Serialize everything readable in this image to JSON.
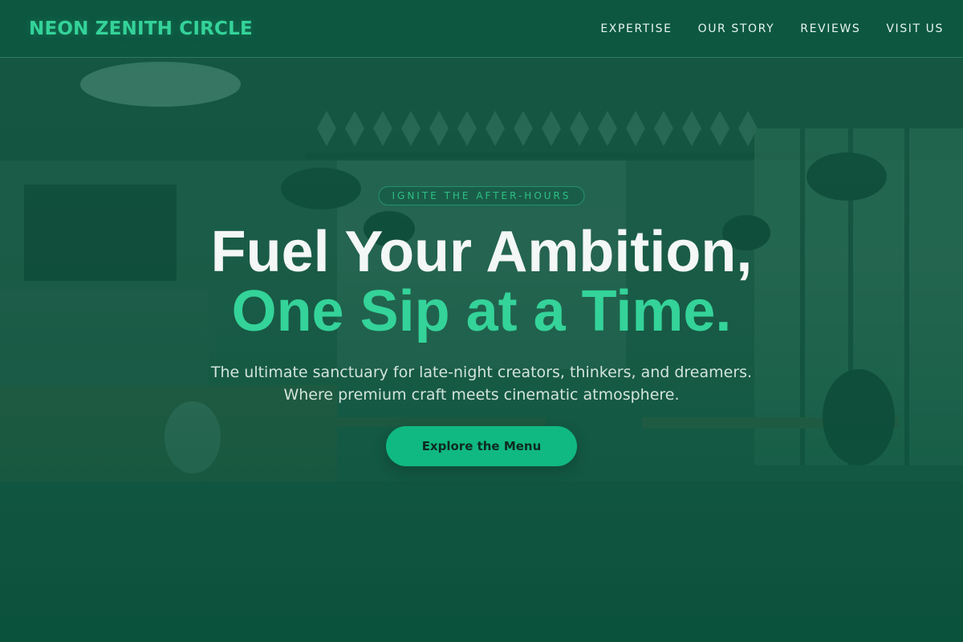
{
  "brand": {
    "name": "NEON ZENITH CIRCLE",
    "accent_color": "#34d399"
  },
  "nav": {
    "items": [
      {
        "label": "EXPERTISE"
      },
      {
        "label": "OUR STORY"
      },
      {
        "label": "REVIEWS"
      },
      {
        "label": "VISIT US"
      }
    ]
  },
  "hero": {
    "tagline": "IGNITE THE AFTER-HOURS",
    "headline_line1": "Fuel Your Ambition,",
    "headline_line2": "One Sip at a Time.",
    "subtitle": "The ultimate sanctuary for late-night creators, thinkers, and dreamers. Where premium craft meets cinematic atmosphere.",
    "cta_label": "Explore the Menu",
    "cta_color": "#10b981"
  },
  "background": {
    "overlay_color": "#0d5f46"
  }
}
